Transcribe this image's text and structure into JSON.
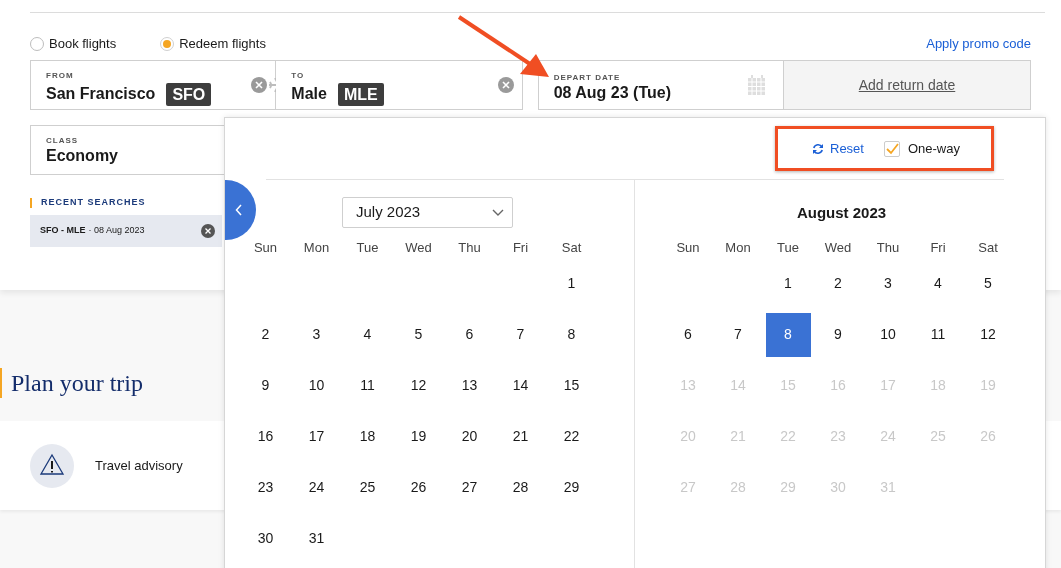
{
  "trip_types": [
    {
      "label": "Book flights",
      "selected": false
    },
    {
      "label": "Redeem flights",
      "selected": true
    }
  ],
  "promo_link": "Apply promo code",
  "from": {
    "label": "FROM",
    "city": "San Francisco",
    "code": "SFO"
  },
  "to": {
    "label": "TO",
    "city": "Male",
    "code": "MLE"
  },
  "depart": {
    "label": "DEPART DATE",
    "value": "08 Aug 23 (Tue)"
  },
  "return_link": "Add return date",
  "class_field": {
    "label": "CLASS",
    "value": "Economy"
  },
  "recent": {
    "title": "RECENT SEARCHES",
    "items": [
      {
        "route": "SFO - MLE",
        "date": "· 08 Aug 2023"
      }
    ]
  },
  "section_title": "Plan your trip",
  "advisory": "Travel advisory",
  "calendar": {
    "reset": "Reset",
    "one_way": {
      "label": "One-way",
      "checked": true
    },
    "months": [
      {
        "kind": "dropdown",
        "title": "July 2023",
        "weekdays": [
          "Sun",
          "Mon",
          "Tue",
          "Wed",
          "Thu",
          "Fri",
          "Sat"
        ],
        "weeks": [
          {
            "kind": "first",
            "days": [
              {
                "day": "1",
                "disabled": false,
                "selected": false
              }
            ]
          },
          {
            "kind": "full",
            "days": [
              {
                "day": "2",
                "disabled": false,
                "selected": false
              },
              {
                "day": "3",
                "disabled": false,
                "selected": false
              },
              {
                "day": "4",
                "disabled": false,
                "selected": false
              },
              {
                "day": "5",
                "disabled": false,
                "selected": false
              },
              {
                "day": "6",
                "disabled": false,
                "selected": false
              },
              {
                "day": "7",
                "disabled": false,
                "selected": false
              },
              {
                "day": "8",
                "disabled": false,
                "selected": false
              }
            ]
          },
          {
            "kind": "full",
            "days": [
              {
                "day": "9",
                "disabled": false,
                "selected": false
              },
              {
                "day": "10",
                "disabled": false,
                "selected": false
              },
              {
                "day": "11",
                "disabled": false,
                "selected": false
              },
              {
                "day": "12",
                "disabled": false,
                "selected": false
              },
              {
                "day": "13",
                "disabled": false,
                "selected": false
              },
              {
                "day": "14",
                "disabled": false,
                "selected": false
              },
              {
                "day": "15",
                "disabled": false,
                "selected": false
              }
            ]
          },
          {
            "kind": "full",
            "days": [
              {
                "day": "16",
                "disabled": false,
                "selected": false
              },
              {
                "day": "17",
                "disabled": false,
                "selected": false
              },
              {
                "day": "18",
                "disabled": false,
                "selected": false
              },
              {
                "day": "19",
                "disabled": false,
                "selected": false
              },
              {
                "day": "20",
                "disabled": false,
                "selected": false
              },
              {
                "day": "21",
                "disabled": false,
                "selected": false
              },
              {
                "day": "22",
                "disabled": false,
                "selected": false
              }
            ]
          },
          {
            "kind": "full",
            "days": [
              {
                "day": "23",
                "disabled": false,
                "selected": false
              },
              {
                "day": "24",
                "disabled": false,
                "selected": false
              },
              {
                "day": "25",
                "disabled": false,
                "selected": false
              },
              {
                "day": "26",
                "disabled": false,
                "selected": false
              },
              {
                "day": "27",
                "disabled": false,
                "selected": false
              },
              {
                "day": "28",
                "disabled": false,
                "selected": false
              },
              {
                "day": "29",
                "disabled": false,
                "selected": false
              }
            ]
          },
          {
            "kind": "last",
            "days": [
              {
                "day": "30",
                "disabled": false,
                "selected": false
              },
              {
                "day": "31",
                "disabled": false,
                "selected": false
              }
            ]
          }
        ]
      },
      {
        "kind": "plain",
        "title": "August 2023",
        "weekdays": [
          "Sun",
          "Mon",
          "Tue",
          "Wed",
          "Thu",
          "Fri",
          "Sat"
        ],
        "weeks": [
          {
            "kind": "first",
            "days": [
              {
                "day": "1",
                "disabled": false,
                "selected": false
              },
              {
                "day": "2",
                "disabled": false,
                "selected": false
              },
              {
                "day": "3",
                "disabled": false,
                "selected": false
              },
              {
                "day": "4",
                "disabled": false,
                "selected": false
              },
              {
                "day": "5",
                "disabled": false,
                "selected": false
              }
            ]
          },
          {
            "kind": "full",
            "days": [
              {
                "day": "6",
                "disabled": false,
                "selected": false
              },
              {
                "day": "7",
                "disabled": false,
                "selected": false
              },
              {
                "day": "8",
                "disabled": false,
                "selected": true
              },
              {
                "day": "9",
                "disabled": false,
                "selected": false
              },
              {
                "day": "10",
                "disabled": false,
                "selected": false
              },
              {
                "day": "11",
                "disabled": false,
                "selected": false
              },
              {
                "day": "12",
                "disabled": false,
                "selected": false
              }
            ]
          },
          {
            "kind": "full",
            "days": [
              {
                "day": "13",
                "disabled": true,
                "selected": false
              },
              {
                "day": "14",
                "disabled": true,
                "selected": false
              },
              {
                "day": "15",
                "disabled": true,
                "selected": false
              },
              {
                "day": "16",
                "disabled": true,
                "selected": false
              },
              {
                "day": "17",
                "disabled": true,
                "selected": false
              },
              {
                "day": "18",
                "disabled": true,
                "selected": false
              },
              {
                "day": "19",
                "disabled": true,
                "selected": false
              }
            ]
          },
          {
            "kind": "full",
            "days": [
              {
                "day": "20",
                "disabled": true,
                "selected": false
              },
              {
                "day": "21",
                "disabled": true,
                "selected": false
              },
              {
                "day": "22",
                "disabled": true,
                "selected": false
              },
              {
                "day": "23",
                "disabled": true,
                "selected": false
              },
              {
                "day": "24",
                "disabled": true,
                "selected": false
              },
              {
                "day": "25",
                "disabled": true,
                "selected": false
              },
              {
                "day": "26",
                "disabled": true,
                "selected": false
              }
            ]
          },
          {
            "kind": "last",
            "days": [
              {
                "day": "27",
                "disabled": true,
                "selected": false
              },
              {
                "day": "28",
                "disabled": true,
                "selected": false
              },
              {
                "day": "29",
                "disabled": true,
                "selected": false
              },
              {
                "day": "30",
                "disabled": true,
                "selected": false
              },
              {
                "day": "31",
                "disabled": true,
                "selected": false
              }
            ]
          }
        ]
      }
    ]
  }
}
